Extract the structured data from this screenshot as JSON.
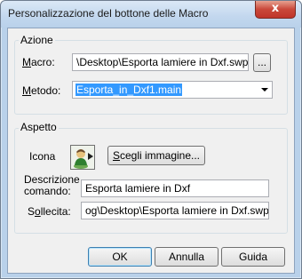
{
  "window": {
    "title": "Personalizzazione del bottone delle Macro",
    "close_glyph": "x"
  },
  "azione": {
    "group_label": "Azione",
    "macro_label_pre": "",
    "macro_label_u": "M",
    "macro_label_post": "acro:",
    "macro_value": "\\Desktop\\Esporta lamiere in Dxf.swp",
    "browse_label": "...",
    "metodo_label_pre": "",
    "metodo_label_u": "M",
    "metodo_label_post": "etodo:",
    "metodo_value": "Esporta_in_Dxf1.main"
  },
  "aspetto": {
    "group_label": "Aspetto",
    "icona_label": "Icona",
    "scegli_pre": "",
    "scegli_u": "S",
    "scegli_post": "cegli immagine...",
    "descr_label_line1": "Descrizione",
    "descr_label_line2": "comando:",
    "descr_value": "Esporta lamiere in Dxf",
    "sollecita_label_pre": "S",
    "sollecita_label_u": "o",
    "sollecita_label_post": "llecita:",
    "sollecita_value": "og\\Desktop\\Esporta lamiere in Dxf.swp"
  },
  "footer": {
    "ok_label": "OK",
    "annulla_label": "Annulla",
    "guida_label": "Guida"
  },
  "colors": {
    "selection": "#3399ff",
    "accent_frame": "#b9d1ea"
  }
}
